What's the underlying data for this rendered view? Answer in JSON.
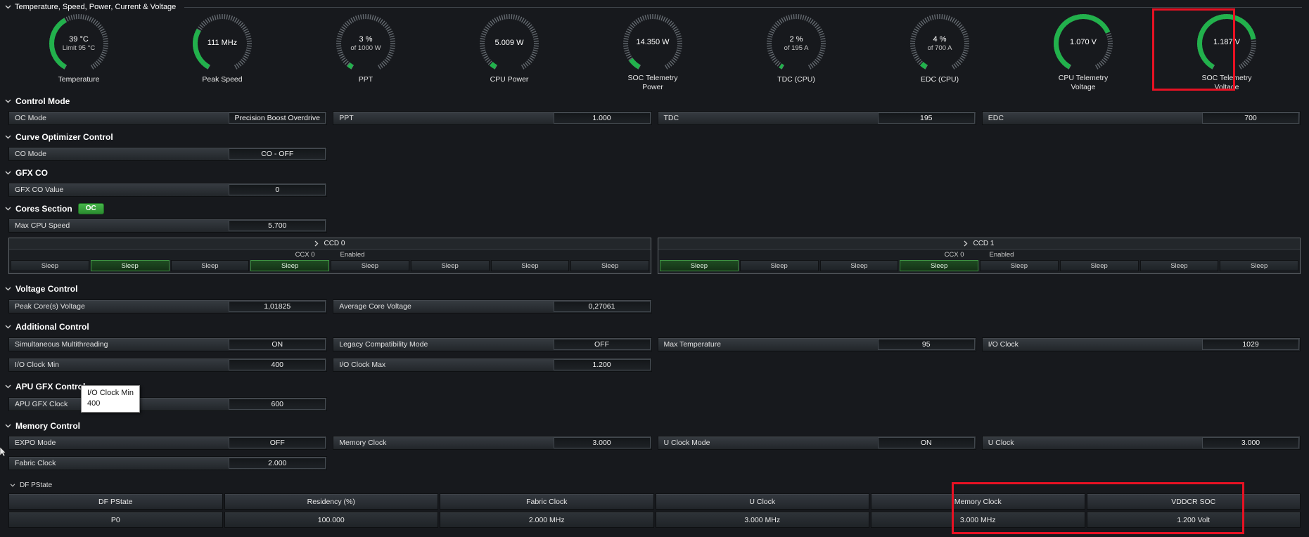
{
  "header": {
    "title": "Temperature, Speed, Power, Current & Voltage"
  },
  "colors": {
    "gauge_green": "#22b14c",
    "gauge_tick_gray": "#656b71",
    "badge_green": "#3aa83f",
    "annotation_red": "#e81123",
    "core_active_green": "#3f9243"
  },
  "gauges": [
    {
      "value": "39 °C",
      "sub": "Limit 95 °C",
      "label": "Temperature",
      "percent": 40
    },
    {
      "value": "111 MHz",
      "sub": "",
      "label": "Peak Speed",
      "percent": 30
    },
    {
      "value": "3 %",
      "sub": "of 1000 W",
      "label": "PPT",
      "percent": 3
    },
    {
      "value": "5.009 W",
      "sub": "",
      "label": "CPU Power",
      "percent": 4
    },
    {
      "value": "14.350 W",
      "sub": "",
      "label": "SOC Telemetry Power",
      "percent": 8
    },
    {
      "value": "2 %",
      "sub": "of 195 A",
      "label": "TDC (CPU)",
      "percent": 2
    },
    {
      "value": "4 %",
      "sub": "of 700 A",
      "label": "EDC (CPU)",
      "percent": 4
    },
    {
      "value": "1.070 V",
      "sub": "",
      "label": "CPU Telemetry Voltage",
      "percent": 72
    },
    {
      "value": "1.187 V",
      "sub": "",
      "label": "SOC Telemetry Voltage",
      "percent": 77
    }
  ],
  "sections": {
    "control_mode": {
      "title": "Control Mode",
      "fields": [
        {
          "label": "OC Mode",
          "value": "Precision Boost Overdrive"
        },
        {
          "label": "PPT",
          "value": "1.000"
        },
        {
          "label": "TDC",
          "value": "195"
        },
        {
          "label": "EDC",
          "value": "700"
        }
      ]
    },
    "curve_optimizer": {
      "title": "Curve Optimizer Control",
      "fields": [
        {
          "label": "CO Mode",
          "value": "CO - OFF"
        }
      ]
    },
    "gfx_co": {
      "title": "GFX CO",
      "fields": [
        {
          "label": "GFX CO Value",
          "value": "0"
        }
      ]
    },
    "cores": {
      "title": "Cores Section",
      "badge": "OC",
      "fields": [
        {
          "label": "Max CPU Speed",
          "value": "5.700"
        }
      ],
      "ccds": [
        {
          "title": "CCD 0",
          "ccx": "CCX 0",
          "status": "Enabled",
          "cores": [
            {
              "state": "Sleep",
              "active": false
            },
            {
              "state": "Sleep",
              "active": true
            },
            {
              "state": "Sleep",
              "active": false
            },
            {
              "state": "Sleep",
              "active": true
            },
            {
              "state": "Sleep",
              "active": false
            },
            {
              "state": "Sleep",
              "active": false
            },
            {
              "state": "Sleep",
              "active": false
            },
            {
              "state": "Sleep",
              "active": false
            }
          ]
        },
        {
          "title": "CCD 1",
          "ccx": "CCX 0",
          "status": "Enabled",
          "cores": [
            {
              "state": "Sleep",
              "active": true
            },
            {
              "state": "Sleep",
              "active": false
            },
            {
              "state": "Sleep",
              "active": false
            },
            {
              "state": "Sleep",
              "active": true
            },
            {
              "state": "Sleep",
              "active": false
            },
            {
              "state": "Sleep",
              "active": false
            },
            {
              "state": "Sleep",
              "active": false
            },
            {
              "state": "Sleep",
              "active": false
            }
          ]
        }
      ]
    },
    "voltage_control": {
      "title": "Voltage Control",
      "fields": [
        {
          "label": "Peak Core(s) Voltage",
          "value": "1,01825"
        },
        {
          "label": "Average Core Voltage",
          "value": "0,27061"
        }
      ]
    },
    "additional_control": {
      "title": "Additional Control",
      "fields_row1": [
        {
          "label": "Simultaneous Multithreading",
          "value": "ON"
        },
        {
          "label": "Legacy Compatibility Mode",
          "value": "OFF"
        },
        {
          "label": "Max Temperature",
          "value": "95"
        },
        {
          "label": "I/O Clock",
          "value": "1029"
        }
      ],
      "fields_row2": [
        {
          "label": "I/O Clock Min",
          "value": "400"
        },
        {
          "label": "I/O Clock Max",
          "value": "1.200"
        }
      ]
    },
    "apu_gfx": {
      "title": "APU GFX Control",
      "fields": [
        {
          "label": "APU GFX Clock",
          "value": "600"
        }
      ]
    },
    "memory_control": {
      "title": "Memory Control",
      "fields_row1": [
        {
          "label": "EXPO Mode",
          "value": "OFF"
        },
        {
          "label": "Memory Clock",
          "value": "3.000"
        },
        {
          "label": "U Clock Mode",
          "value": "ON"
        },
        {
          "label": "U Clock",
          "value": "3.000"
        }
      ],
      "fields_row2": [
        {
          "label": "Fabric Clock",
          "value": "2.000"
        }
      ]
    },
    "df_pstate": {
      "title": "DF PState",
      "columns": [
        "DF PState",
        "Residency (%)",
        "Fabric Clock",
        "U Clock",
        "Memory Clock",
        "VDDCR SOC"
      ],
      "rows": [
        [
          "P0",
          "100.000",
          "2.000 MHz",
          "3.000 MHz",
          "3.000 MHz",
          "1.200 Volt"
        ]
      ]
    }
  },
  "tooltip": {
    "title": "I/O Clock Min",
    "value": "400"
  }
}
